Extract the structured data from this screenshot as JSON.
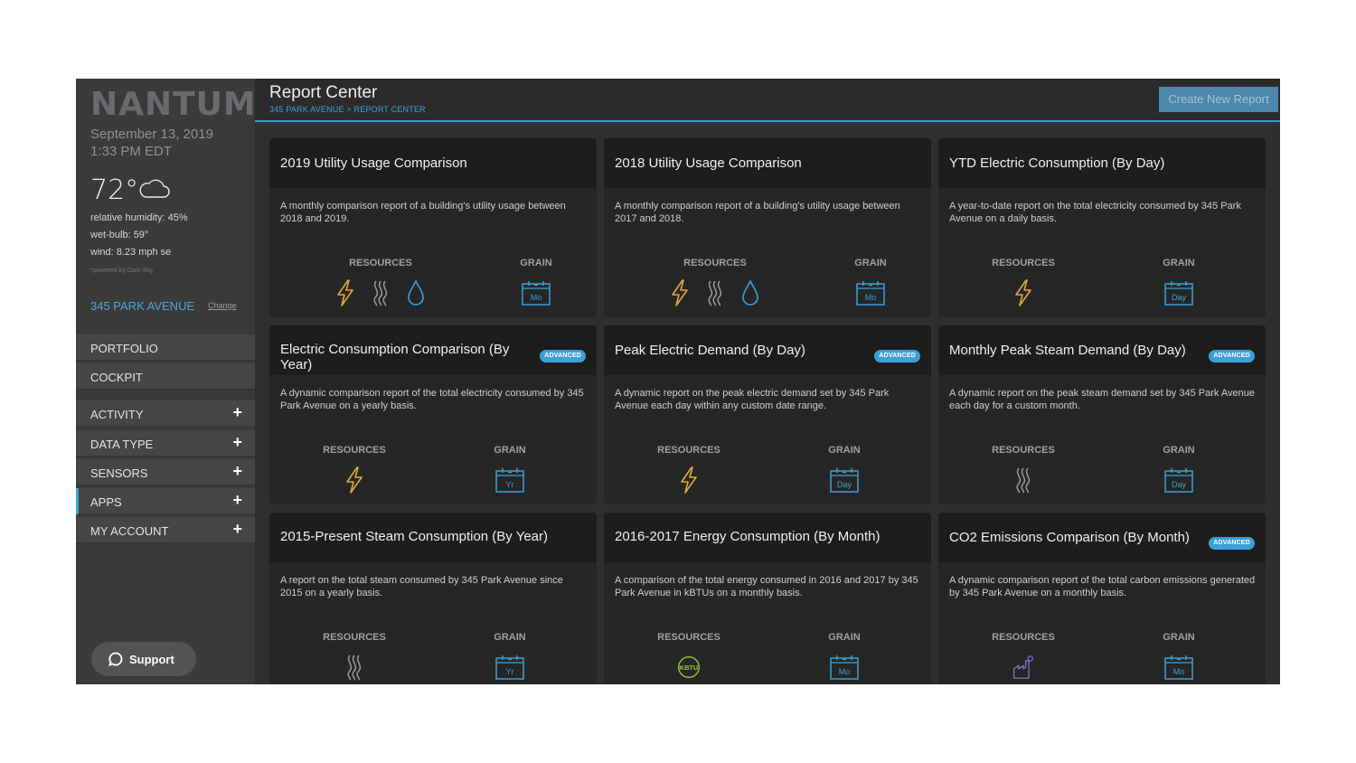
{
  "sidebar": {
    "logo": "NANTUM",
    "date": "September 13, 2019",
    "time": "1:33 PM EDT",
    "temperature": "72°",
    "humidity": "relative humidity: 45%",
    "wet_bulb": "wet-bulb: 59°",
    "wind": "wind: 8.23 mph se",
    "powered_by": "*powered by Dark Sky",
    "building": "345 PARK AVENUE",
    "change_label": "Change",
    "nav": [
      {
        "label": "PORTFOLIO",
        "expandable": false
      },
      {
        "label": "COCKPIT",
        "expandable": false
      },
      {
        "label": "ACTIVITY",
        "expandable": true
      },
      {
        "label": "DATA TYPE",
        "expandable": true
      },
      {
        "label": "SENSORS",
        "expandable": true
      },
      {
        "label": "APPS",
        "expandable": true,
        "active": true
      },
      {
        "label": "MY ACCOUNT",
        "expandable": true
      }
    ],
    "plus_symbol": "+",
    "support_label": "Support"
  },
  "header": {
    "title": "Report Center",
    "breadcrumb": "345 PARK AVENUE > REPORT CENTER",
    "create_button": "Create New Report"
  },
  "labels": {
    "resources": "RESOURCES",
    "grain": "GRAIN",
    "advanced": "ADVANCED"
  },
  "colors": {
    "accent": "#3d9fd6",
    "electric": "#e0a93a",
    "water": "#3e9fd7",
    "steam": "#9a9a9a",
    "kbtu": "#9fc13a",
    "co2": "#8a6fd0"
  },
  "cards": [
    {
      "title": "2019 Utility Usage Comparison",
      "advanced": false,
      "description": "A monthly comparison report of a building's utility usage between 2018 and 2019.",
      "resources": [
        "electric",
        "steam",
        "water"
      ],
      "grain": "Mo"
    },
    {
      "title": "2018 Utility Usage Comparison",
      "advanced": false,
      "description": "A monthly comparison report of a building's utility usage between 2017 and 2018.",
      "resources": [
        "electric",
        "steam",
        "water"
      ],
      "grain": "Mo"
    },
    {
      "title": "YTD Electric Consumption (By Day)",
      "advanced": false,
      "description": "A year-to-date report on the total electricity consumed by 345 Park Avenue on a daily basis.",
      "resources": [
        "electric"
      ],
      "grain": "Day"
    },
    {
      "title": "Electric Consumption Comparison (By Year)",
      "advanced": true,
      "description": "A dynamic comparison report of the total electricity consumed by 345 Park Avenue on a yearly basis.",
      "resources": [
        "electric"
      ],
      "grain": "Yr"
    },
    {
      "title": "Peak Electric Demand (By Day)",
      "advanced": true,
      "description": "A dynamic report on the peak electric demand set by 345 Park Avenue each day within any custom date range.",
      "resources": [
        "electric"
      ],
      "grain": "Day"
    },
    {
      "title": "Monthly Peak Steam Demand (By Day)",
      "advanced": true,
      "description": "A dynamic report on the peak steam demand set by 345 Park Avenue each day for a custom month.",
      "resources": [
        "steam"
      ],
      "grain": "Day"
    },
    {
      "title": "2015-Present Steam Consumption (By Year)",
      "advanced": false,
      "description": "A report on the total steam consumed by 345 Park Avenue since 2015 on a yearly basis.",
      "resources": [
        "steam"
      ],
      "grain": "Yr"
    },
    {
      "title": "2016-2017 Energy Consumption (By Month)",
      "advanced": false,
      "description": "A comparison of the total energy consumed in 2016 and 2017 by 345 Park Avenue in kBTUs on a monthly basis.",
      "resources": [
        "kbtu"
      ],
      "grain": "Mo"
    },
    {
      "title": "CO2 Emissions Comparison (By Month)",
      "advanced": true,
      "description": "A dynamic comparison report of the total carbon emissions generated by 345 Park Avenue on a monthly basis.",
      "resources": [
        "co2"
      ],
      "grain": "Mo"
    }
  ],
  "kbtu_label": "KBTU"
}
